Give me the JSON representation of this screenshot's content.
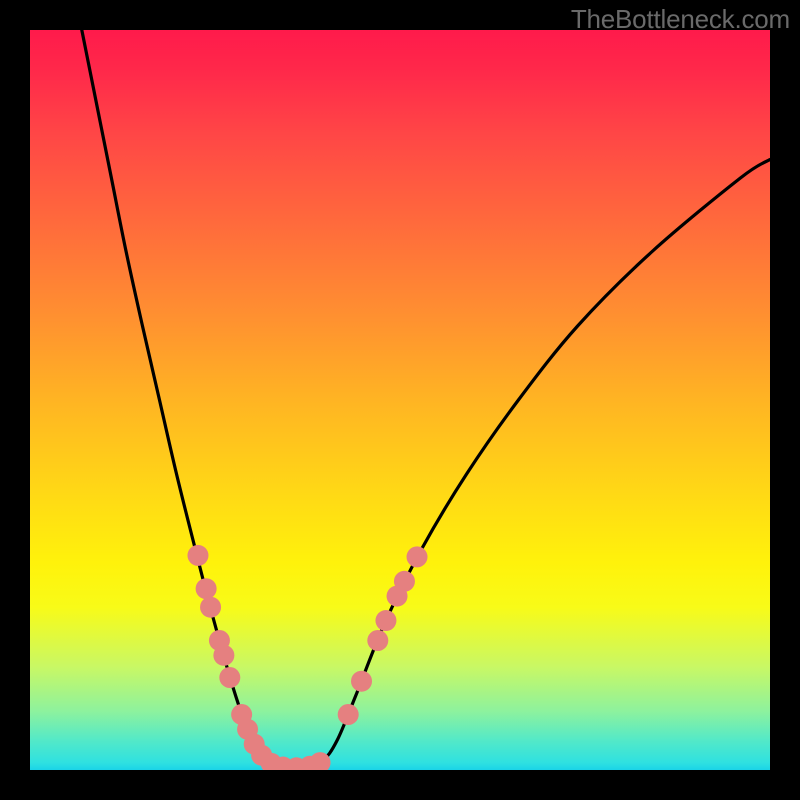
{
  "watermark": "TheBottleneck.com",
  "colors": {
    "frame": "#000000",
    "curve": "#000000",
    "dots": "#e58080"
  },
  "chart_data": {
    "type": "line",
    "title": "",
    "xlabel": "",
    "ylabel": "",
    "xlim": [
      0,
      100
    ],
    "ylim": [
      0,
      100
    ],
    "grid": false,
    "legend": false,
    "series": [
      {
        "name": "bottleneck-curve",
        "color": "#000000",
        "curve_points": [
          {
            "x": 7.0,
            "y": 100.0
          },
          {
            "x": 9.0,
            "y": 90.0
          },
          {
            "x": 11.0,
            "y": 80.0
          },
          {
            "x": 13.0,
            "y": 70.0
          },
          {
            "x": 15.2,
            "y": 60.0
          },
          {
            "x": 17.5,
            "y": 50.0
          },
          {
            "x": 19.8,
            "y": 40.0
          },
          {
            "x": 22.3,
            "y": 30.0
          },
          {
            "x": 24.9,
            "y": 20.0
          },
          {
            "x": 27.8,
            "y": 10.0
          },
          {
            "x": 30.0,
            "y": 4.0
          },
          {
            "x": 32.0,
            "y": 1.2
          },
          {
            "x": 34.5,
            "y": 0.3
          },
          {
            "x": 37.0,
            "y": 0.3
          },
          {
            "x": 39.5,
            "y": 1.2
          },
          {
            "x": 41.5,
            "y": 4.0
          },
          {
            "x": 44.0,
            "y": 10.0
          },
          {
            "x": 48.0,
            "y": 20.0
          },
          {
            "x": 53.0,
            "y": 30.0
          },
          {
            "x": 59.0,
            "y": 40.0
          },
          {
            "x": 66.0,
            "y": 50.0
          },
          {
            "x": 74.0,
            "y": 60.0
          },
          {
            "x": 84.0,
            "y": 70.0
          },
          {
            "x": 96.0,
            "y": 80.0
          },
          {
            "x": 100.0,
            "y": 82.5
          }
        ]
      },
      {
        "name": "data-points-left-branch",
        "color": "#e58080",
        "points": [
          {
            "x": 22.7,
            "y": 29.0
          },
          {
            "x": 23.8,
            "y": 24.5
          },
          {
            "x": 24.4,
            "y": 22.0
          },
          {
            "x": 25.6,
            "y": 17.5
          },
          {
            "x": 26.2,
            "y": 15.5
          },
          {
            "x": 27.0,
            "y": 12.5
          },
          {
            "x": 28.6,
            "y": 7.5
          },
          {
            "x": 29.4,
            "y": 5.5
          },
          {
            "x": 30.3,
            "y": 3.5
          },
          {
            "x": 31.3,
            "y": 2.0
          }
        ]
      },
      {
        "name": "data-points-trough",
        "color": "#e58080",
        "points": [
          {
            "x": 32.6,
            "y": 0.9
          },
          {
            "x": 34.2,
            "y": 0.4
          },
          {
            "x": 36.0,
            "y": 0.3
          },
          {
            "x": 37.8,
            "y": 0.5
          },
          {
            "x": 39.2,
            "y": 1.0
          }
        ]
      },
      {
        "name": "data-points-right-branch",
        "color": "#e58080",
        "points": [
          {
            "x": 43.0,
            "y": 7.5
          },
          {
            "x": 44.8,
            "y": 12.0
          },
          {
            "x": 47.0,
            "y": 17.5
          },
          {
            "x": 48.1,
            "y": 20.2
          },
          {
            "x": 49.6,
            "y": 23.5
          },
          {
            "x": 50.6,
            "y": 25.5
          },
          {
            "x": 52.3,
            "y": 28.8
          }
        ]
      }
    ]
  }
}
